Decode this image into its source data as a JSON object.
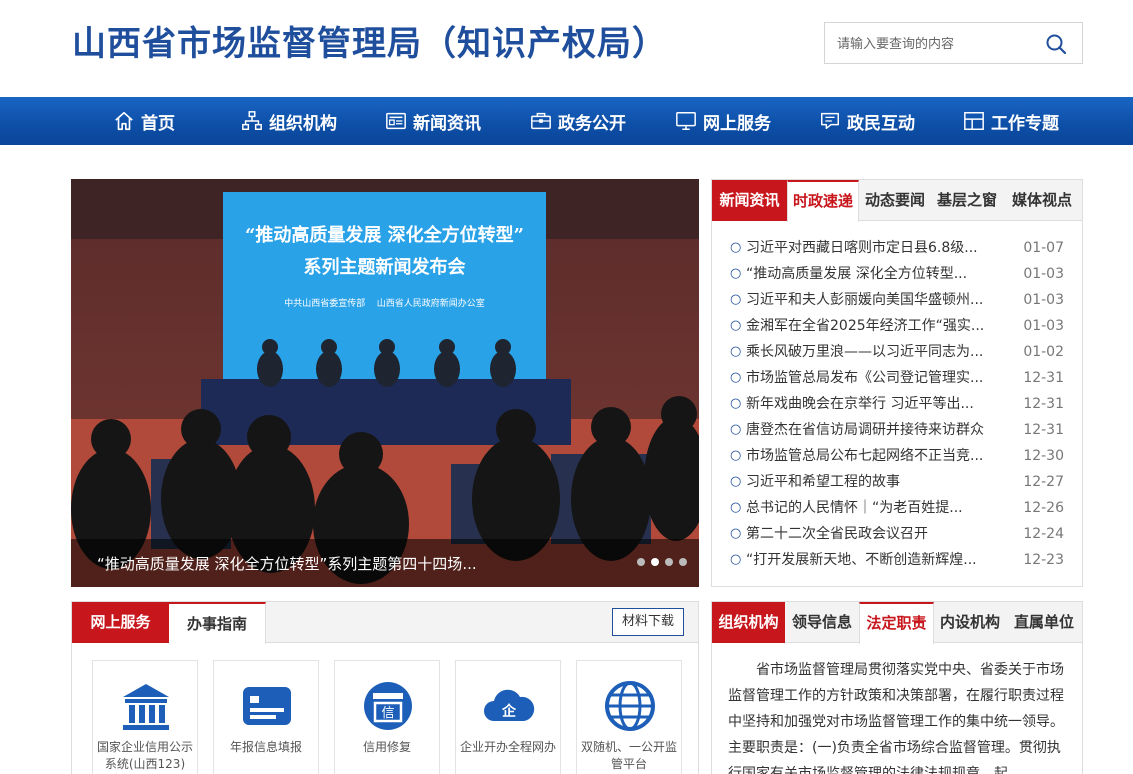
{
  "site": {
    "title": "山西省市场监督管理局（知识产权局）"
  },
  "search": {
    "placeholder": "请输入要查询的内容"
  },
  "nav": {
    "items": [
      {
        "label": "首页",
        "icon": "home-icon"
      },
      {
        "label": "组织机构",
        "icon": "org-chart-icon"
      },
      {
        "label": "新闻资讯",
        "icon": "newspaper-icon"
      },
      {
        "label": "政务公开",
        "icon": "briefcase-icon"
      },
      {
        "label": "网上服务",
        "icon": "monitor-icon"
      },
      {
        "label": "政民互动",
        "icon": "chat-icon"
      },
      {
        "label": "工作专题",
        "icon": "layout-icon"
      }
    ]
  },
  "slider": {
    "banner_title_line1": "“推动高质量发展  深化全方位转型”",
    "banner_title_line2": "系列主题新闻发布会",
    "banner_organizers": "中共山西省委宣传部    山西省人民政府新闻办公室",
    "caption": "“推动高质量发展 深化全方位转型”系列主题第四十四场...",
    "dots": 4,
    "active_dot": 1
  },
  "news": {
    "tabs": [
      "新闻资讯",
      "时政速递",
      "动态要闻",
      "基层之窗",
      "媒体视点"
    ],
    "active_tab": "时政速递",
    "items": [
      {
        "title": "习近平对西藏日喀则市定日县6.8级...",
        "date": "01-07"
      },
      {
        "title": "“推动高质量发展 深化全方位转型...",
        "date": "01-03"
      },
      {
        "title": "习近平和夫人彭丽媛向美国华盛顿州...",
        "date": "01-03"
      },
      {
        "title": "金湘军在全省2025年经济工作“强实...",
        "date": "01-03"
      },
      {
        "title": "乘长风破万里浪——以习近平同志为...",
        "date": "01-02"
      },
      {
        "title": "市场监管总局发布《公司登记管理实...",
        "date": "12-31"
      },
      {
        "title": "新年戏曲晚会在京举行 习近平等出...",
        "date": "12-31"
      },
      {
        "title": "唐登杰在省信访局调研并接待来访群众",
        "date": "12-31"
      },
      {
        "title": "市场监管总局公布七起网络不正当竞...",
        "date": "12-30"
      },
      {
        "title": "习近平和希望工程的故事",
        "date": "12-27"
      },
      {
        "title": "总书记的人民情怀｜“为老百姓提...",
        "date": "12-26"
      },
      {
        "title": "第二十二次全省民政会议召开",
        "date": "12-24"
      },
      {
        "title": "“打开发展新天地、不断创造新辉煌...",
        "date": "12-23"
      }
    ]
  },
  "services": {
    "tabs": [
      "网上服务",
      "办事指南"
    ],
    "download_label": "材料下载",
    "cards": [
      {
        "label": "国家企业信用公示系统(山西123)",
        "icon": "government-building-icon"
      },
      {
        "label": "年报信息填报",
        "icon": "id-card-icon"
      },
      {
        "label": "信用修复",
        "icon": "credit-repair-icon"
      },
      {
        "label": "企业开办全程网办",
        "icon": "cloud-enterprise-icon"
      },
      {
        "label": "双随机、一公开监管平台",
        "icon": "globe-icon"
      }
    ]
  },
  "org": {
    "tabs": [
      "组织机构",
      "领导信息",
      "法定职责",
      "内设机构",
      "直属单位"
    ],
    "active_tab": "法定职责",
    "text": "省市场监督管理局贯彻落实党中央、省委关于市场监督管理工作的方针政策和决策部署，在履行职责过程中坚持和加强党对市场监督管理工作的集中统一领导。主要职责是：(一)负责全省市场综合监督管理。贯彻执行国家有关市场监督管理的法律法规规章，起"
  },
  "colors": {
    "brand_blue": "#1f4e9c",
    "nav_blue": "#0d4ea6",
    "accent_red": "#c8161d",
    "banner_blue": "#2aa2e8"
  }
}
